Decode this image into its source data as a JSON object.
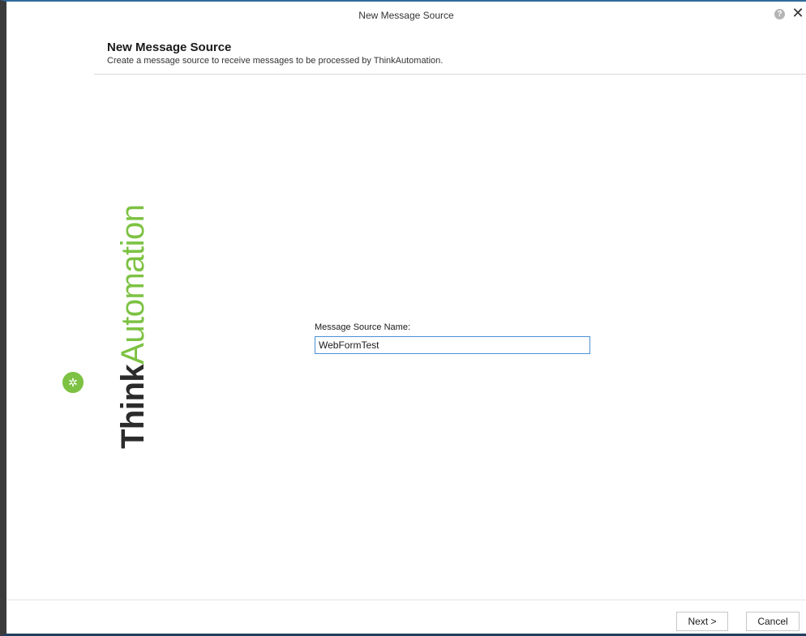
{
  "window": {
    "title": "New Message Source",
    "help_icon": "question-circle-icon",
    "close_icon": "close-icon",
    "close_glyph": "✕",
    "help_glyph": "?"
  },
  "header": {
    "title": "New Message Source",
    "subtitle": "Create a message source to receive messages to be processed by ThinkAutomation."
  },
  "brand": {
    "think": "Think",
    "automation": "Automation",
    "logo_icon": "gear-icon",
    "logo_glyph": "✲",
    "colors": {
      "think": "#2b2b2b",
      "automation": "#7dc243"
    }
  },
  "form": {
    "name_label": "Message Source Name:",
    "name_value": "WebFormTest"
  },
  "footer": {
    "next_label": "Next >",
    "cancel_label": "Cancel"
  },
  "colors": {
    "accent": "#4a90d9",
    "brand_green": "#7dc243"
  }
}
